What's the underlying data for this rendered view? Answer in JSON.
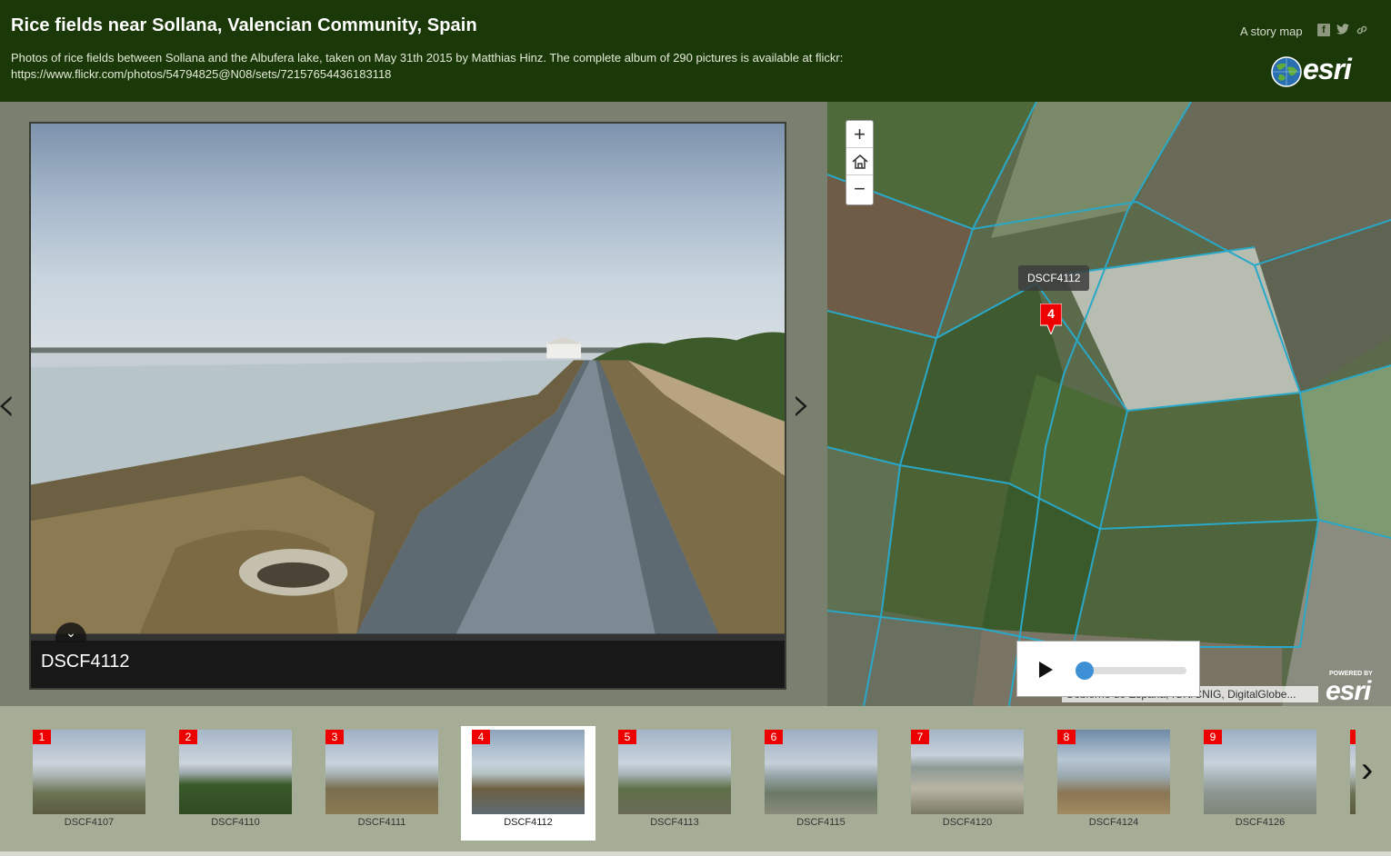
{
  "header": {
    "title": "Rice fields near Sollana, Valencian Community, Spain",
    "subtitle_line1": "Photos of rice fields between Sollana and the Albufera lake, taken on May 31th 2015 by Matthias Hinz. The complete album of 290 pictures is available at flickr:",
    "subtitle_line2": "https://www.flickr.com/photos/54794825@N08/sets/72157654436183118",
    "story_map_label": "A story map",
    "share_icons": [
      "facebook-icon",
      "twitter-icon",
      "link-icon"
    ],
    "logo_text": "esri"
  },
  "photo": {
    "caption": "DSCF4112"
  },
  "map": {
    "tooltip": "DSCF4112",
    "marker_number": "4",
    "attribution": "Gobierno de España, IGN/CNIG, DigitalGlobe...",
    "powered_by": "POWERED BY",
    "powered_logo": "esri",
    "zoom_in": "+",
    "zoom_out": "−",
    "home_icon": "home-icon",
    "slider_value": 0
  },
  "carousel": {
    "items": [
      {
        "num": "1",
        "label": "DSCF4107"
      },
      {
        "num": "2",
        "label": "DSCF4110"
      },
      {
        "num": "3",
        "label": "DSCF4111"
      },
      {
        "num": "4",
        "label": "DSCF4112"
      },
      {
        "num": "5",
        "label": "DSCF4113"
      },
      {
        "num": "6",
        "label": "DSCF4115"
      },
      {
        "num": "7",
        "label": "DSCF4120"
      },
      {
        "num": "8",
        "label": "DSCF4124"
      },
      {
        "num": "9",
        "label": "DSCF4126"
      }
    ],
    "active_index": 3
  },
  "colors": {
    "header_bg": "#1a3808",
    "marker_red": "#e00000",
    "carousel_bg": "#a5ad97",
    "slider_blue": "#3d8fd6"
  }
}
